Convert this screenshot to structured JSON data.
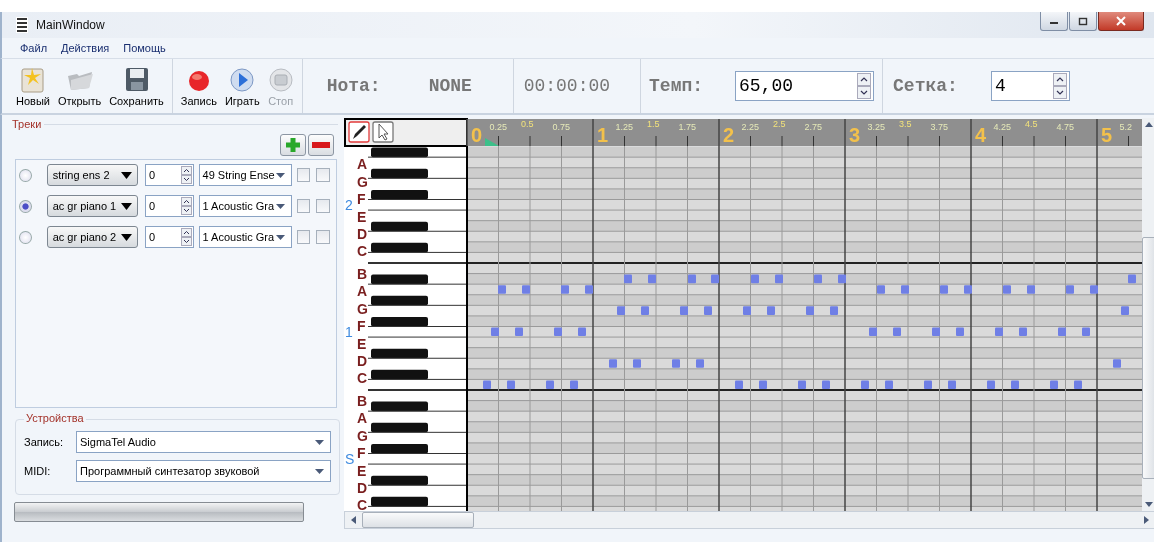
{
  "window": {
    "title": "MainWindow"
  },
  "menu": [
    "Файл",
    "Действия",
    "Помощь"
  ],
  "toolbar": [
    {
      "kind": "new",
      "label": "Новый",
      "disabled": false
    },
    {
      "kind": "open",
      "label": "Открыть",
      "disabled": false
    },
    {
      "kind": "save",
      "label": "Сохранить",
      "disabled": false
    },
    {
      "kind": "record",
      "label": "Запись",
      "disabled": false
    },
    {
      "kind": "play",
      "label": "Играть",
      "disabled": false
    },
    {
      "kind": "stop",
      "label": "Стоп",
      "disabled": true
    }
  ],
  "status": {
    "note_label": "Нота:",
    "note_value": "NONE",
    "time": "00:00:00",
    "tempo_label": "Темп:",
    "tempo_value": "65,00",
    "grid_label": "Сетка:",
    "grid_value": "4"
  },
  "tracks": {
    "title": "Треки",
    "items": [
      {
        "selected": false,
        "name": "string ens 2",
        "volume": "0",
        "instrument": "49 String Ense",
        "check_a": false,
        "check_b": false
      },
      {
        "selected": true,
        "name": "ac gr piano 1",
        "volume": "0",
        "instrument": "1 Acoustic Gra",
        "check_a": false,
        "check_b": false
      },
      {
        "selected": false,
        "name": "ac gr piano 2",
        "volume": "0",
        "instrument": "1 Acoustic Gra",
        "check_a": false,
        "check_b": false
      }
    ]
  },
  "devices": {
    "title": "Устройства",
    "rows": [
      {
        "label": "Запись:",
        "value": "SigmaTel Audio"
      },
      {
        "label": "MIDI:",
        "value": "Программный синтезатор звуковой"
      }
    ]
  },
  "piano_roll": {
    "tools": [
      {
        "kind": "pencil",
        "selected": true
      },
      {
        "kind": "pointer",
        "selected": false
      }
    ],
    "ruler": [
      {
        "label": "0",
        "kind": "beat"
      },
      {
        "label": "0.25",
        "kind": "quarter"
      },
      {
        "label": "0.5",
        "kind": "half"
      },
      {
        "label": "0.75",
        "kind": "quarter"
      },
      {
        "label": "1",
        "kind": "beat"
      },
      {
        "label": "1.25",
        "kind": "quarter"
      },
      {
        "label": "1.5",
        "kind": "half"
      },
      {
        "label": "1.75",
        "kind": "quarter"
      },
      {
        "label": "2",
        "kind": "beat"
      },
      {
        "label": "2.25",
        "kind": "quarter"
      },
      {
        "label": "2.5",
        "kind": "half"
      },
      {
        "label": "2.75",
        "kind": "quarter"
      },
      {
        "label": "3",
        "kind": "beat"
      },
      {
        "label": "3.25",
        "kind": "quarter"
      },
      {
        "label": "3.5",
        "kind": "half"
      },
      {
        "label": "3.75",
        "kind": "quarter"
      },
      {
        "label": "4",
        "kind": "beat"
      },
      {
        "label": "4.25",
        "kind": "quarter"
      },
      {
        "label": "4.5",
        "kind": "half"
      },
      {
        "label": "4.75",
        "kind": "quarter"
      },
      {
        "label": "5",
        "kind": "beat"
      },
      {
        "label": "5.2",
        "kind": "quarter"
      }
    ],
    "octaves": [
      {
        "label": "2",
        "keys": [
          "A",
          "G",
          "F",
          "E",
          "D",
          "C"
        ]
      },
      {
        "label": "1",
        "keys": [
          "B",
          "A",
          "G",
          "F",
          "E",
          "D",
          "C"
        ]
      },
      {
        "label": "S",
        "keys": [
          "B",
          "A",
          "G",
          "F",
          "E",
          "D",
          "C"
        ]
      }
    ]
  }
}
